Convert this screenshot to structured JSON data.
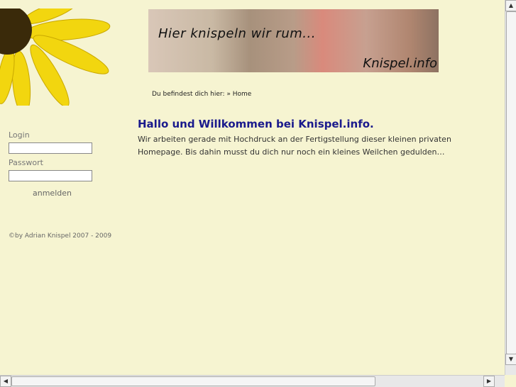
{
  "banner": {
    "tagline": "Hier knispeln wir rum...",
    "site": "Knispel.info"
  },
  "breadcrumb": {
    "prefix": "Du befindest dich hier:",
    "separator": "»",
    "current": "Home"
  },
  "login": {
    "login_label": "Login",
    "password_label": "Passwort",
    "login_value": "",
    "password_value": "",
    "submit_label": "anmelden"
  },
  "footer": {
    "copyright": "©by Adrian Knispel 2007 - 2009"
  },
  "main": {
    "title": "Hallo und Willkommen bei Knispel.info.",
    "body": "Wir arbeiten gerade mit Hochdruck an der Fertigstellung dieser kleinen privaten Homepage. Bis dahin musst du dich nur noch ein kleines Weilchen gedulden…"
  },
  "scrollbar": {
    "up": "▲",
    "down": "▼",
    "left": "◀",
    "right": "▶"
  }
}
